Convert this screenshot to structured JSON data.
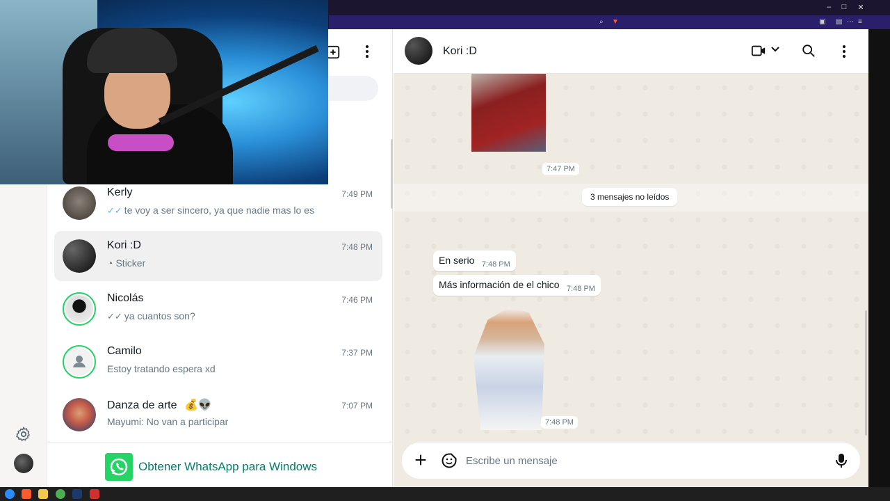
{
  "browser": {
    "minimize": "–",
    "maximize": "□",
    "close": "✕"
  },
  "chat_list": {
    "chats": [
      {
        "name": "Kerly",
        "time": "7:49 PM",
        "preview": "te voy a ser sincero, ya  que nadie mas lo es",
        "tick": "✓✓"
      },
      {
        "name": "Kori :D",
        "time": "7:48 PM",
        "preview": "Sticker",
        "tick": ""
      },
      {
        "name": "Nicolás",
        "time": "7:46 PM",
        "preview": "ya cuantos son?",
        "tick": "✓✓"
      },
      {
        "name": "Camilo",
        "time": "7:37 PM",
        "preview": "Estoy tratando espera xd",
        "tick": ""
      },
      {
        "name": "Danza de arte",
        "emoji": "💰👽",
        "time": "7:07 PM",
        "preview": "Mayumi: No van a participar",
        "tick": ""
      }
    ],
    "get_windows_label": "Obtener WhatsApp para Windows"
  },
  "conversation": {
    "contact_name": "Kori :D",
    "messages": [
      {
        "type": "time",
        "time": "7:47 PM"
      },
      {
        "type": "unread",
        "text": "3 mensajes no leídos"
      },
      {
        "type": "text",
        "text": "En serio",
        "time": "7:48 PM"
      },
      {
        "type": "text",
        "text": "Más información de el chico",
        "time": "7:48 PM"
      },
      {
        "type": "time",
        "time": "7:48 PM"
      }
    ],
    "composer_placeholder": "Escribe un mensaje"
  },
  "colors": {
    "accent": "#25d366",
    "link": "#008069",
    "read_tick": "#53bdeb",
    "chat_background": "#efeae2"
  },
  "icons": {
    "rail": [
      "settings-icon",
      "profile-avatar"
    ],
    "list_header": [
      "new-chat-icon",
      "menu-icon"
    ],
    "conv_header": [
      "video-call-icon",
      "chevron-down-icon",
      "search-icon",
      "menu-icon"
    ],
    "composer": [
      "plus-icon",
      "sticker-icon",
      "mic-icon"
    ]
  }
}
